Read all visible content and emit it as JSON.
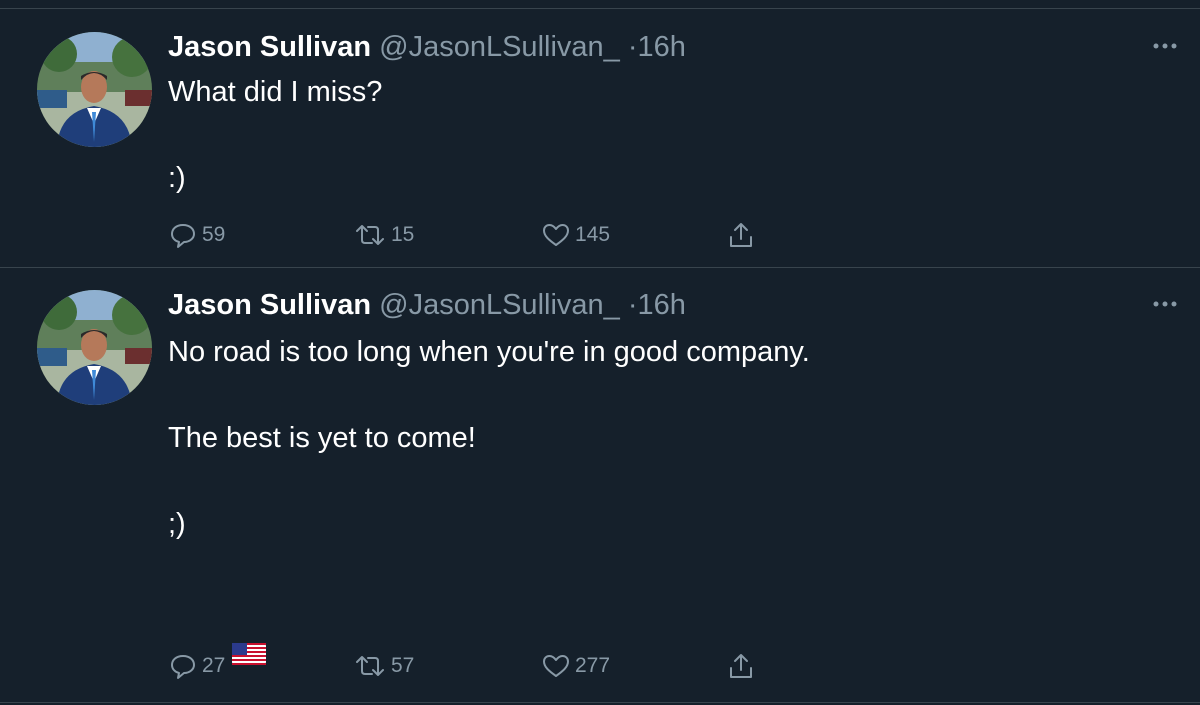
{
  "tweets": [
    {
      "author_name": "Jason Sullivan",
      "handle": "@JasonLSullivan_",
      "separator": "·",
      "time": "16h",
      "lines": [
        "What did I miss?",
        "",
        ":)"
      ],
      "replies": "59",
      "retweets": "15",
      "likes": "145"
    },
    {
      "author_name": "Jason Sullivan",
      "handle": "@JasonLSullivan_",
      "separator": "·",
      "time": "16h",
      "lines": [
        "No road is too long when you're in good company.",
        "",
        "The best is yet to come!",
        "",
        ";)",
        ""
      ],
      "emoji": "us-flag-emoji",
      "replies": "27",
      "retweets": "57",
      "likes": "277"
    }
  ],
  "colors": {
    "background": "#15202b",
    "divider": "#38444d",
    "secondary_text": "#8899a6",
    "primary_text": "#ffffff"
  },
  "icons": [
    "reply-icon",
    "retweet-icon",
    "like-icon",
    "share-icon",
    "more-icon"
  ]
}
